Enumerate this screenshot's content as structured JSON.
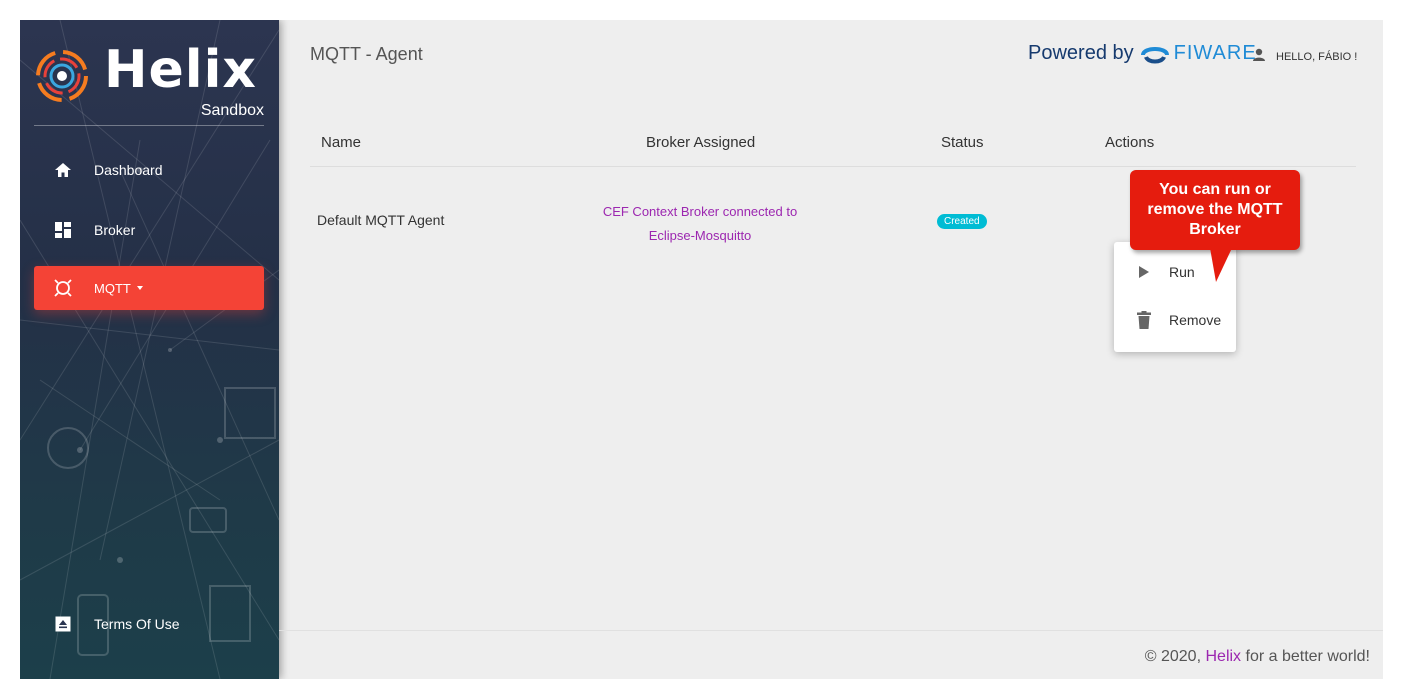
{
  "sidebar": {
    "brand_name": "Helix",
    "brand_sub": "Sandbox",
    "items": [
      {
        "label": "Dashboard",
        "icon": "home-icon"
      },
      {
        "label": "Broker",
        "icon": "dashboard-icon"
      },
      {
        "label": "MQTT",
        "icon": "mqtt-icon",
        "active": true
      }
    ],
    "terms_label": "Terms Of Use"
  },
  "header": {
    "title": "MQTT - Agent",
    "powered_by": "Powered by",
    "fiware": "FIWARE",
    "user_greeting": "HELLO, FÁBIO !"
  },
  "table": {
    "columns": [
      "Name",
      "Broker Assigned",
      "Status",
      "Actions"
    ],
    "rows": [
      {
        "name": "Default MQTT Agent",
        "broker_line1": "CEF Context Broker connected to",
        "broker_line2": "Eclipse-Mosquitto",
        "status": "Created"
      }
    ]
  },
  "menu": {
    "items": [
      {
        "label": "Run",
        "icon": "play-icon"
      },
      {
        "label": "Remove",
        "icon": "trash-icon"
      }
    ]
  },
  "callout": {
    "line1": "You can run or",
    "line2": "remove the MQTT",
    "line3": "Broker"
  },
  "footer": {
    "prefix": "© 2020,",
    "link": "Helix",
    "suffix": "for a better world!"
  },
  "colors": {
    "accent": "#f44336",
    "link": "#9c27b0",
    "badge": "#00bcd4",
    "callout": "#e51c0e"
  }
}
